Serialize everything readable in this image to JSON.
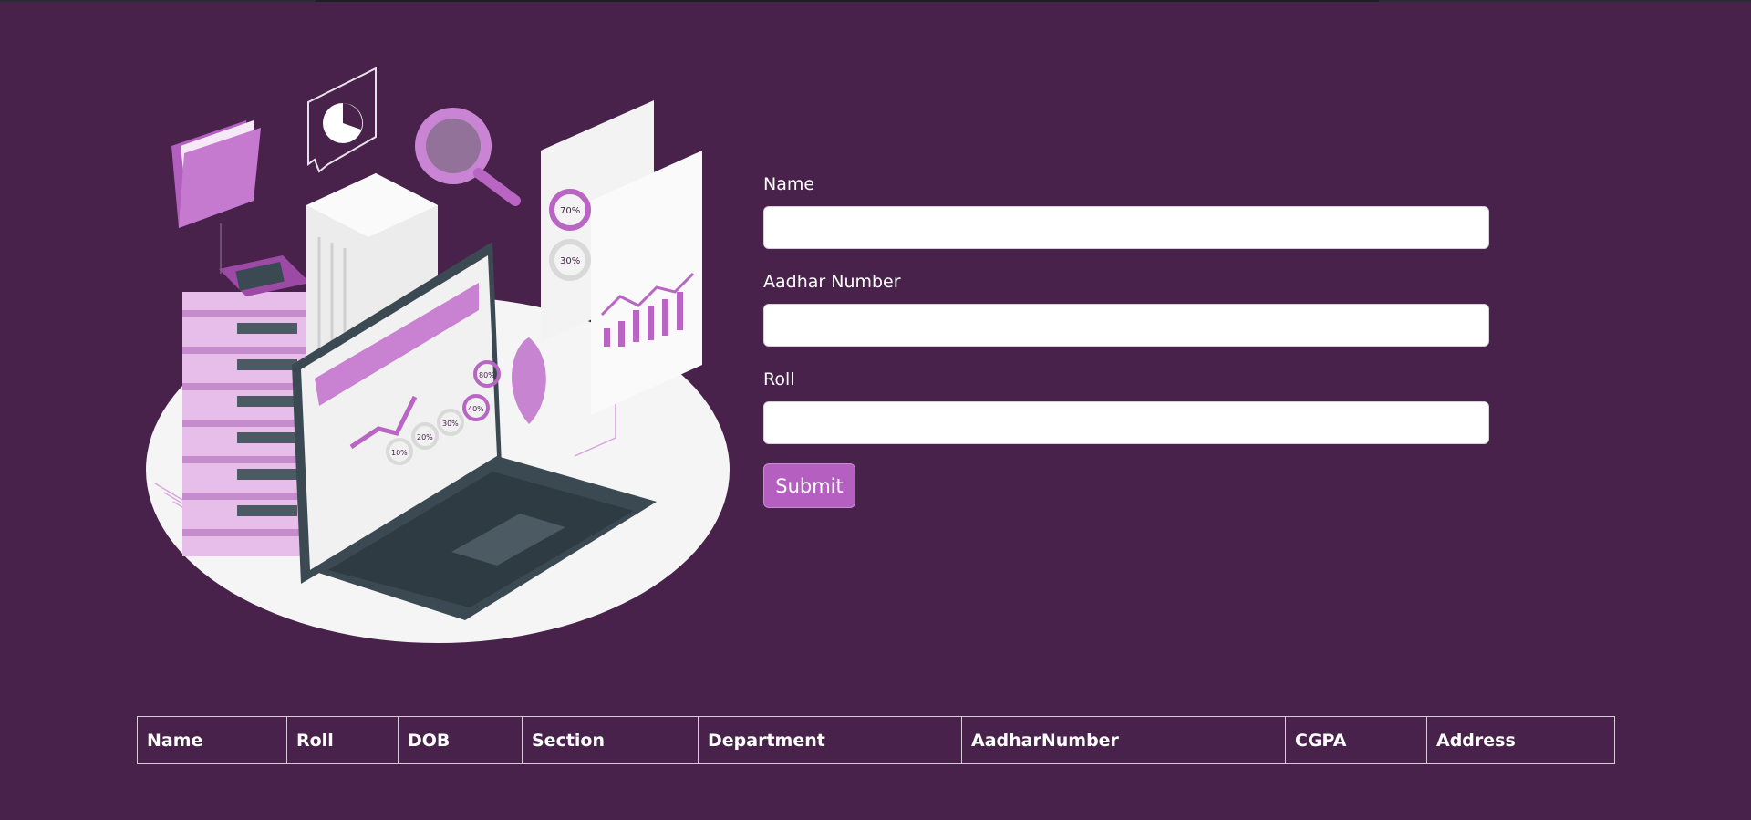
{
  "form": {
    "name_label": "Name",
    "name_value": "",
    "aadhar_label": "Aadhar Number",
    "aadhar_value": "",
    "roll_label": "Roll",
    "roll_value": "",
    "submit_label": "Submit"
  },
  "illustration": {
    "icon": "laptop-data-analysis-illustration",
    "gauge_labels": [
      "70%",
      "30%",
      "10%",
      "20%",
      "30%",
      "40%",
      "80%"
    ]
  },
  "table": {
    "headers": [
      "Name",
      "Roll",
      "DOB",
      "Section",
      "Department",
      "AadharNumber",
      "CGPA",
      "Address"
    ]
  },
  "colors": {
    "background": "#48224b",
    "accent": "#b55fc0",
    "input_background": "#ffffff"
  }
}
